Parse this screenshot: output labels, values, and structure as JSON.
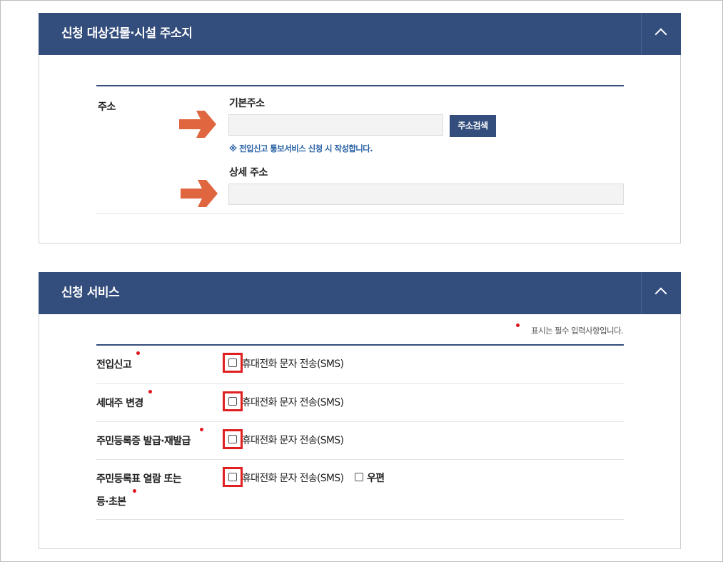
{
  "section_address": {
    "title": "신청 대상건물·시설 주소지",
    "row_label": "주소",
    "basic_address_label": "기본주소",
    "basic_address_value": "",
    "search_button": "주소검색",
    "note": "※ 전입신고 통보서비스 신청 시 작성합니다.",
    "detail_address_label": "상세 주소",
    "detail_address_value": ""
  },
  "section_service": {
    "title": "신청 서비스",
    "required_note": "표시는 필수 입력사항입니다.",
    "services": [
      {
        "label": "전입신고",
        "option": "휴대전화 문자 전송(SMS)"
      },
      {
        "label": "세대주 변경",
        "option": "휴대전화 문자 전송(SMS)"
      },
      {
        "label": "주민등록증 발급·재발급",
        "option": "휴대전화 문자 전송(SMS)"
      },
      {
        "label_line1": "주민등록표 열람 또는",
        "label_line2": "등·초본",
        "option": "휴대전화 문자 전송(SMS)",
        "extra_option": "우편"
      }
    ]
  },
  "colors": {
    "header": "#334d7c",
    "required_dot": "#e0151e",
    "highlight_box": "#e02020",
    "arrow": "#e0663f",
    "note": "#2a62a5"
  }
}
